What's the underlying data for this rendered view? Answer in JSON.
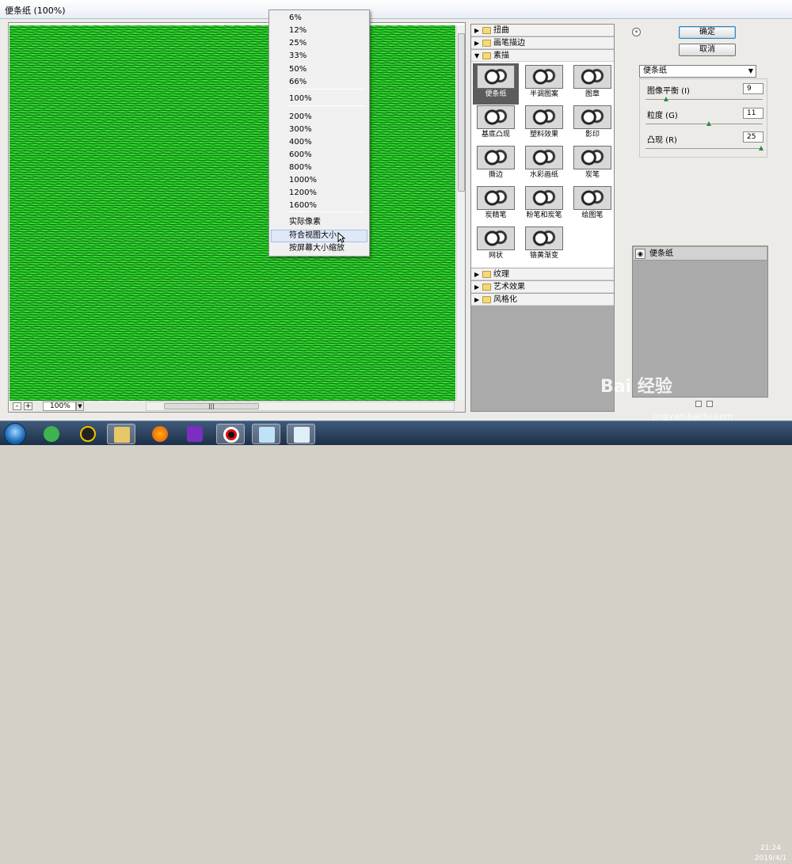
{
  "window": {
    "title": "便条纸 (100%)"
  },
  "zoom_menu": {
    "items": [
      "6%",
      "12%",
      "25%",
      "33%",
      "50%",
      "66%",
      "100%",
      "200%",
      "300%",
      "400%",
      "600%",
      "800%",
      "1000%",
      "1200%",
      "1600%",
      "实际像素",
      "符合视图大小",
      "按屏幕大小缩放"
    ],
    "highlighted": "符合视图大小"
  },
  "preview": {
    "zoom_value": "100%",
    "zoom_minus": "-",
    "zoom_plus": "+"
  },
  "filter_tree": {
    "categories_top": [
      "扭曲",
      "画笔描边",
      "素描"
    ],
    "categories_bottom": [
      "纹理",
      "艺术效果",
      "风格化"
    ],
    "sketch_filters": [
      "便条纸",
      "半调图案",
      "图章",
      "基底凸现",
      "塑料效果",
      "影印",
      "撕边",
      "水彩画纸",
      "炭笔",
      "炭精笔",
      "粉笔和炭笔",
      "绘图笔",
      "网状",
      "铬黄渐变"
    ],
    "selected": "便条纸"
  },
  "buttons": {
    "ok": "确定",
    "cancel": "取消"
  },
  "settings": {
    "filter_select": "便条纸",
    "params": [
      {
        "label": "图像平衡 (I)",
        "value": "9",
        "min": 0,
        "max": 50,
        "level": 9
      },
      {
        "label": "粒度 (G)",
        "value": "11",
        "min": 0,
        "max": 20,
        "level": 11
      },
      {
        "label": "凸现 (R)",
        "value": "25",
        "min": 0,
        "max": 25,
        "level": 25
      }
    ]
  },
  "layers": {
    "items": [
      "便条纸"
    ]
  },
  "watermark": {
    "logo": "Bai 经验",
    "url": "jingyan.baidu.com"
  },
  "taskbar": {
    "clock_time": "21:24",
    "clock_date": "2019/4/1"
  },
  "colors": {
    "preview_green": "#2bd42b",
    "menu_highlight": "#dfe8f6",
    "taskbar": "#1c3048"
  }
}
